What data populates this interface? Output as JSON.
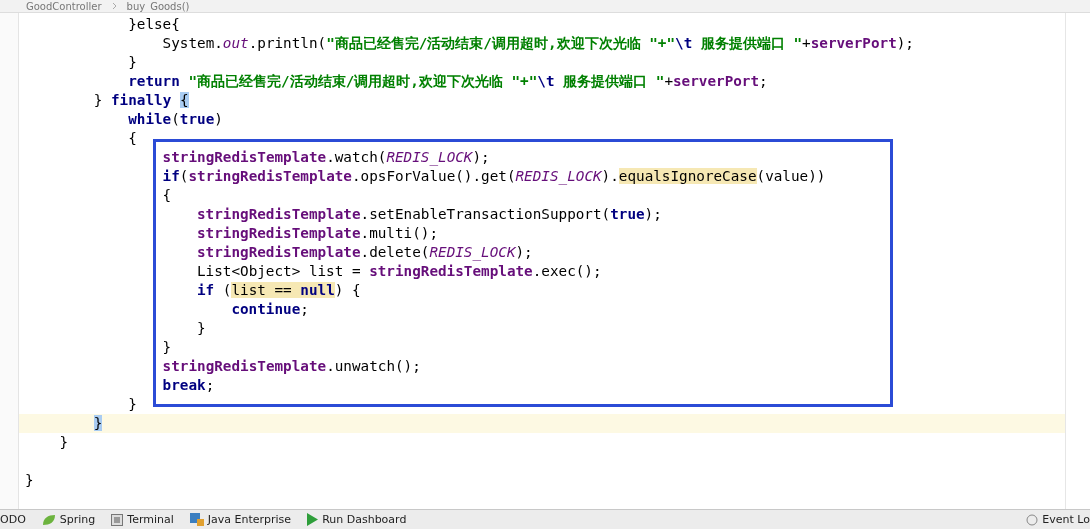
{
  "breadcrumb": [
    "GoodController",
    "buy_Goods()"
  ],
  "lines": [
    {
      "kind": "group",
      "children": [
        {
          "kind": "group",
          "children": [
            {
              "kind": "group",
              "children": [
                {
                  "kind": "line",
                  "current": false,
                  "tokens": [
                    {
                      "text": "}else{",
                      "kind": "plain"
                    }
                  ],
                  "children": [
                    {
                      "kind": "line",
                      "current": false,
                      "tokens": [
                        {
                          "text": "System.",
                          "kind": "plain"
                        },
                        {
                          "text": "out",
                          "kind": "static"
                        },
                        {
                          "text": ".println(",
                          "kind": "plain"
                        },
                        {
                          "text": "\"商品已经售完/活动结束/调用超时,欢迎下次光临 \"+\"",
                          "kind": "string"
                        },
                        {
                          "text": "\\t",
                          "kind": "keyword"
                        },
                        {
                          "text": " 服务提供端口 \"",
                          "kind": "string"
                        },
                        {
                          "text": "+",
                          "kind": "plain"
                        },
                        {
                          "text": "serverPort",
                          "kind": "field"
                        },
                        {
                          "text": ");",
                          "kind": "plain"
                        }
                      ]
                    }
                  ]
                },
                {
                  "kind": "line",
                  "current": false,
                  "tokens": [
                    {
                      "text": "}",
                      "kind": "plain"
                    }
                  ]
                },
                {
                  "kind": "line",
                  "current": false,
                  "tokens": [
                    {
                      "text": "return ",
                      "kind": "keyword"
                    },
                    {
                      "text": "\"商品已经售完/活动结束/调用超时,欢迎下次光临 \"+\"",
                      "kind": "string"
                    },
                    {
                      "text": "\\t",
                      "kind": "keyword"
                    },
                    {
                      "text": " 服务提供端口 \"",
                      "kind": "string"
                    },
                    {
                      "text": "+",
                      "kind": "plain"
                    },
                    {
                      "text": "serverPort",
                      "kind": "field"
                    },
                    {
                      "text": ";",
                      "kind": "plain"
                    }
                  ]
                }
              ]
            },
            {
              "kind": "line",
              "current": false,
              "tokens": [
                {
                  "text": "} ",
                  "kind": "plain"
                },
                {
                  "text": "finally ",
                  "kind": "keyword"
                },
                {
                  "text": "{",
                  "kind": "plain",
                  "brace_match": true
                }
              ],
              "children": [
                {
                  "kind": "line",
                  "current": false,
                  "tokens": [
                    {
                      "text": "while",
                      "kind": "keyword"
                    },
                    {
                      "text": "(",
                      "kind": "plain"
                    },
                    {
                      "text": "true",
                      "kind": "keyword"
                    },
                    {
                      "text": ")",
                      "kind": "plain"
                    }
                  ]
                },
                {
                  "kind": "line",
                  "current": false,
                  "tokens": [
                    {
                      "text": "{",
                      "kind": "plain"
                    }
                  ],
                  "children": [
                    {
                      "kind": "line",
                      "current": false,
                      "tokens": [
                        {
                          "text": "stringRedisTemplate",
                          "kind": "field"
                        },
                        {
                          "text": ".watch(",
                          "kind": "plain"
                        },
                        {
                          "text": "REDIS_LOCK",
                          "kind": "constant"
                        },
                        {
                          "text": ");",
                          "kind": "plain"
                        }
                      ]
                    },
                    {
                      "kind": "line",
                      "current": false,
                      "tokens": [
                        {
                          "text": "if",
                          "kind": "keyword"
                        },
                        {
                          "text": "(",
                          "kind": "plain"
                        },
                        {
                          "text": "stringRedisTemplate",
                          "kind": "field"
                        },
                        {
                          "text": ".opsForValue().get(",
                          "kind": "plain"
                        },
                        {
                          "text": "REDIS_LOCK",
                          "kind": "constant"
                        },
                        {
                          "text": ").",
                          "kind": "plain"
                        },
                        {
                          "text": "equalsIgnoreCase",
                          "kind": "plain",
                          "highlighted": true
                        },
                        {
                          "text": "(value))",
                          "kind": "plain"
                        }
                      ]
                    },
                    {
                      "kind": "line",
                      "current": false,
                      "tokens": [
                        {
                          "text": "{",
                          "kind": "plain"
                        }
                      ],
                      "children": [
                        {
                          "kind": "line",
                          "current": false,
                          "tokens": [
                            {
                              "text": "stringRedisTemplate",
                              "kind": "field"
                            },
                            {
                              "text": ".setEnableTransactionSupport(",
                              "kind": "plain"
                            },
                            {
                              "text": "true",
                              "kind": "keyword"
                            },
                            {
                              "text": ");",
                              "kind": "plain"
                            }
                          ]
                        },
                        {
                          "kind": "line",
                          "current": false,
                          "tokens": [
                            {
                              "text": "stringRedisTemplate",
                              "kind": "field"
                            },
                            {
                              "text": ".multi();",
                              "kind": "plain"
                            }
                          ]
                        },
                        {
                          "kind": "line",
                          "current": false,
                          "tokens": [
                            {
                              "text": "stringRedisTemplate",
                              "kind": "field"
                            },
                            {
                              "text": ".delete(",
                              "kind": "plain"
                            },
                            {
                              "text": "REDIS_LOCK",
                              "kind": "constant"
                            },
                            {
                              "text": ");",
                              "kind": "plain"
                            }
                          ]
                        },
                        {
                          "kind": "line",
                          "current": false,
                          "tokens": [
                            {
                              "text": "List<Object> list = ",
                              "kind": "plain"
                            },
                            {
                              "text": "stringRedisTemplate",
                              "kind": "field"
                            },
                            {
                              "text": ".exec();",
                              "kind": "plain"
                            }
                          ]
                        },
                        {
                          "kind": "line",
                          "current": false,
                          "tokens": [
                            {
                              "text": "if ",
                              "kind": "keyword"
                            },
                            {
                              "text": "(",
                              "kind": "plain"
                            },
                            {
                              "text": "list == ",
                              "kind": "plain",
                              "highlighted": true
                            },
                            {
                              "text": "null",
                              "kind": "keyword",
                              "highlighted": true
                            },
                            {
                              "text": ") {",
                              "kind": "plain"
                            }
                          ],
                          "children": [
                            {
                              "kind": "line",
                              "current": false,
                              "tokens": [
                                {
                                  "text": "continue",
                                  "kind": "keyword"
                                },
                                {
                                  "text": ";",
                                  "kind": "plain"
                                }
                              ]
                            }
                          ]
                        },
                        {
                          "kind": "line",
                          "current": false,
                          "tokens": [
                            {
                              "text": "}",
                              "kind": "plain"
                            }
                          ]
                        }
                      ]
                    },
                    {
                      "kind": "line",
                      "current": false,
                      "tokens": [
                        {
                          "text": "}",
                          "kind": "plain"
                        }
                      ]
                    },
                    {
                      "kind": "line",
                      "current": false,
                      "tokens": [
                        {
                          "text": "stringRedisTemplate",
                          "kind": "field"
                        },
                        {
                          "text": ".unwatch();",
                          "kind": "plain"
                        }
                      ]
                    },
                    {
                      "kind": "line",
                      "current": false,
                      "tokens": [
                        {
                          "text": "break",
                          "kind": "keyword"
                        },
                        {
                          "text": ";",
                          "kind": "plain"
                        }
                      ]
                    }
                  ]
                },
                {
                  "kind": "line",
                  "current": false,
                  "tokens": [
                    {
                      "text": "}",
                      "kind": "plain"
                    }
                  ]
                }
              ]
            },
            {
              "kind": "line",
              "current": true,
              "tokens": [
                {
                  "text": "}",
                  "kind": "plain",
                  "brace_match": true
                }
              ]
            }
          ]
        },
        {
          "kind": "line",
          "current": false,
          "tokens": [
            {
              "text": "}",
              "kind": "plain"
            }
          ]
        }
      ]
    },
    {
      "kind": "blank"
    },
    {
      "kind": "line",
      "current": false,
      "tokens": [
        {
          "text": "}",
          "kind": "plain"
        }
      ]
    }
  ],
  "status_bar": [
    {
      "label": "ODO"
    },
    {
      "label": "Spring",
      "kind": "leaf"
    },
    {
      "label": "Terminal",
      "kind": "terminal"
    },
    {
      "label": "Java Enterprise",
      "kind": "enterprise"
    },
    {
      "label": "Run Dashboard",
      "kind": "run"
    },
    {
      "label": "Event Lo",
      "kind": "log"
    }
  ]
}
